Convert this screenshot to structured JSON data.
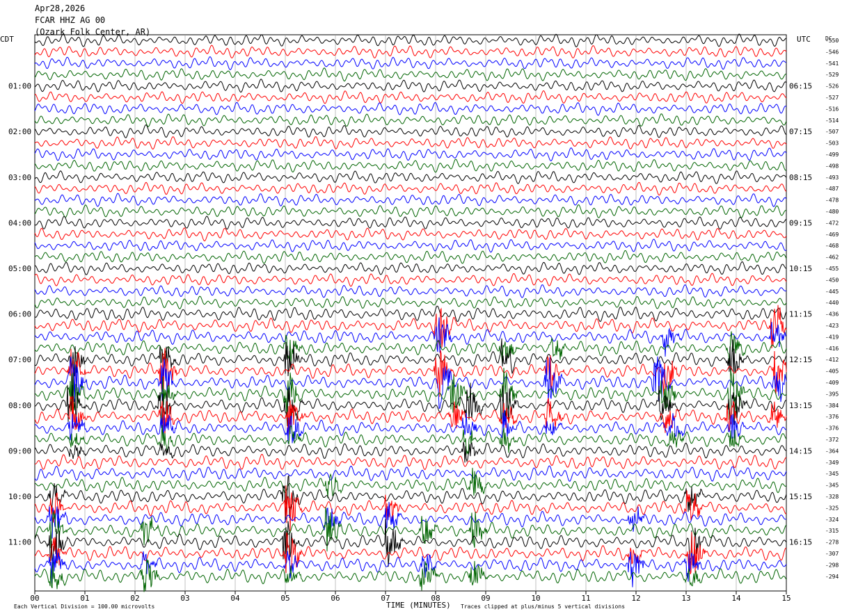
{
  "header": {
    "date": "Apr28,2026",
    "channel": "FCAR HHZ AG 00",
    "site": "(Ozark Folk Center, AR)"
  },
  "footer": {
    "scale_note": "Each Vertical Division = 100.00 microvolts",
    "clip_note": "Traces clipped at plus/minus 5 vertical divisions"
  },
  "chart_data": {
    "type": "line",
    "title": "",
    "xlabel": "TIME (MINUTES)",
    "left_axis_label": "CDT",
    "right_axis_label": "UTC",
    "dc_label": "DC",
    "x_range": [
      0,
      15
    ],
    "x_ticks": [
      "00",
      "01",
      "02",
      "03",
      "04",
      "05",
      "06",
      "07",
      "08",
      "09",
      "10",
      "11",
      "12",
      "13",
      "14",
      "15"
    ],
    "trace_colors": [
      "#000000",
      "#ff0000",
      "#0000ff",
      "#006400"
    ],
    "row_count": 48,
    "left_time_labels": [
      {
        "row": 4,
        "label": "01:00"
      },
      {
        "row": 8,
        "label": "02:00"
      },
      {
        "row": 12,
        "label": "03:00"
      },
      {
        "row": 16,
        "label": "04:00"
      },
      {
        "row": 20,
        "label": "05:00"
      },
      {
        "row": 24,
        "label": "06:00"
      },
      {
        "row": 28,
        "label": "07:00"
      },
      {
        "row": 32,
        "label": "08:00"
      },
      {
        "row": 36,
        "label": "09:00"
      },
      {
        "row": 40,
        "label": "10:00"
      },
      {
        "row": 44,
        "label": "11:00"
      }
    ],
    "right_time_labels": [
      {
        "row": 4,
        "label": "06:15"
      },
      {
        "row": 8,
        "label": "07:15"
      },
      {
        "row": 12,
        "label": "08:15"
      },
      {
        "row": 16,
        "label": "09:15"
      },
      {
        "row": 20,
        "label": "10:15"
      },
      {
        "row": 24,
        "label": "11:15"
      },
      {
        "row": 28,
        "label": "12:15"
      },
      {
        "row": 32,
        "label": "13:15"
      },
      {
        "row": 36,
        "label": "14:15"
      },
      {
        "row": 40,
        "label": "15:15"
      },
      {
        "row": 44,
        "label": "16:15"
      }
    ],
    "dc_offsets": [
      "-550",
      "-546",
      "-541",
      "-529",
      "-526",
      "-527",
      "-516",
      "-514",
      "-507",
      "-503",
      "-499",
      "-498",
      "-493",
      "-487",
      "-478",
      "-480",
      "-472",
      "-469",
      "-468",
      "-462",
      "-455",
      "-450",
      "-445",
      "-440",
      "-436",
      "-423",
      "-419",
      "-416",
      "-412",
      "-405",
      "-409",
      "-395",
      "-384",
      "-376",
      "-376",
      "-372",
      "-364",
      "-349",
      "-345",
      "-345",
      "-328",
      "-325",
      "-324",
      "-315",
      "-278",
      "-307",
      "-298",
      "-294"
    ],
    "events": [
      {
        "row": 28,
        "x": 0.75,
        "amp": 4
      },
      {
        "row": 29,
        "x": 0.75,
        "amp": 5
      },
      {
        "row": 30,
        "x": 0.75,
        "amp": 5
      },
      {
        "row": 31,
        "x": 0.75,
        "amp": 4
      },
      {
        "row": 32,
        "x": 0.7,
        "amp": 5
      },
      {
        "row": 33,
        "x": 0.75,
        "amp": 4
      },
      {
        "row": 34,
        "x": 0.75,
        "amp": 3
      },
      {
        "row": 35,
        "x": 0.75,
        "amp": 2
      },
      {
        "row": 36,
        "x": 0.75,
        "amp": 1.5
      },
      {
        "row": 28,
        "x": 2.55,
        "amp": 3
      },
      {
        "row": 29,
        "x": 2.55,
        "amp": 5
      },
      {
        "row": 30,
        "x": 2.55,
        "amp": 4
      },
      {
        "row": 31,
        "x": 2.55,
        "amp": 3.5
      },
      {
        "row": 32,
        "x": 2.5,
        "amp": 5
      },
      {
        "row": 33,
        "x": 2.55,
        "amp": 3.5
      },
      {
        "row": 34,
        "x": 2.55,
        "amp": 3
      },
      {
        "row": 35,
        "x": 2.55,
        "amp": 2
      },
      {
        "row": 36,
        "x": 2.55,
        "amp": 1.5
      },
      {
        "row": 27,
        "x": 5.05,
        "amp": 3
      },
      {
        "row": 28,
        "x": 5.05,
        "amp": 4
      },
      {
        "row": 31,
        "x": 5.05,
        "amp": 5
      },
      {
        "row": 32,
        "x": 5.05,
        "amp": 5
      },
      {
        "row": 33,
        "x": 5.1,
        "amp": 4
      },
      {
        "row": 34,
        "x": 5.1,
        "amp": 3
      },
      {
        "row": 35,
        "x": 5.1,
        "amp": 2
      },
      {
        "row": 25,
        "x": 8.05,
        "amp": 5
      },
      {
        "row": 26,
        "x": 8.05,
        "amp": 4
      },
      {
        "row": 29,
        "x": 8.05,
        "amp": 5
      },
      {
        "row": 30,
        "x": 8.1,
        "amp": 5
      },
      {
        "row": 31,
        "x": 8.35,
        "amp": 4
      },
      {
        "row": 32,
        "x": 8.65,
        "amp": 5
      },
      {
        "row": 33,
        "x": 8.35,
        "amp": 3
      },
      {
        "row": 34,
        "x": 8.6,
        "amp": 3
      },
      {
        "row": 35,
        "x": 8.6,
        "amp": 2
      },
      {
        "row": 36,
        "x": 8.6,
        "amp": 2
      },
      {
        "row": 27,
        "x": 9.35,
        "amp": 3
      },
      {
        "row": 28,
        "x": 9.35,
        "amp": 4
      },
      {
        "row": 31,
        "x": 9.35,
        "amp": 5
      },
      {
        "row": 32,
        "x": 9.35,
        "amp": 5
      },
      {
        "row": 33,
        "x": 9.35,
        "amp": 3
      },
      {
        "row": 34,
        "x": 9.35,
        "amp": 3
      },
      {
        "row": 35,
        "x": 9.35,
        "amp": 2
      },
      {
        "row": 29,
        "x": 10.25,
        "amp": 4
      },
      {
        "row": 30,
        "x": 10.25,
        "amp": 5
      },
      {
        "row": 33,
        "x": 10.25,
        "amp": 3
      },
      {
        "row": 34,
        "x": 10.25,
        "amp": 2
      },
      {
        "row": 27,
        "x": 10.35,
        "amp": 2.5
      },
      {
        "row": 29,
        "x": 12.6,
        "amp": 4
      },
      {
        "row": 30,
        "x": 12.4,
        "amp": 5
      },
      {
        "row": 31,
        "x": 12.55,
        "amp": 4
      },
      {
        "row": 32,
        "x": 12.5,
        "amp": 3
      },
      {
        "row": 33,
        "x": 12.6,
        "amp": 3
      },
      {
        "row": 34,
        "x": 12.7,
        "amp": 3
      },
      {
        "row": 35,
        "x": 12.7,
        "amp": 2
      },
      {
        "row": 26,
        "x": 12.6,
        "amp": 2.5
      },
      {
        "row": 27,
        "x": 13.9,
        "amp": 3
      },
      {
        "row": 28,
        "x": 13.9,
        "amp": 4
      },
      {
        "row": 31,
        "x": 13.9,
        "amp": 5
      },
      {
        "row": 32,
        "x": 13.9,
        "amp": 5
      },
      {
        "row": 33,
        "x": 13.85,
        "amp": 4
      },
      {
        "row": 34,
        "x": 13.9,
        "amp": 3
      },
      {
        "row": 35,
        "x": 13.9,
        "amp": 2
      },
      {
        "row": 25,
        "x": 14.75,
        "amp": 5
      },
      {
        "row": 26,
        "x": 14.75,
        "amp": 4
      },
      {
        "row": 29,
        "x": 14.8,
        "amp": 5
      },
      {
        "row": 30,
        "x": 14.8,
        "amp": 3
      },
      {
        "row": 33,
        "x": 14.75,
        "amp": 3
      },
      {
        "row": 40,
        "x": 0.35,
        "amp": 3
      },
      {
        "row": 41,
        "x": 0.35,
        "amp": 4
      },
      {
        "row": 42,
        "x": 0.35,
        "amp": 4
      },
      {
        "row": 43,
        "x": 0.35,
        "amp": 4
      },
      {
        "row": 44,
        "x": 0.35,
        "amp": 5
      },
      {
        "row": 45,
        "x": 0.35,
        "amp": 3
      },
      {
        "row": 46,
        "x": 0.35,
        "amp": 3
      },
      {
        "row": 47,
        "x": 0.35,
        "amp": 3
      },
      {
        "row": 43,
        "x": 2.2,
        "amp": 3
      },
      {
        "row": 47,
        "x": 2.2,
        "amp": 4
      },
      {
        "row": 46,
        "x": 2.2,
        "amp": 2
      },
      {
        "row": 40,
        "x": 5.0,
        "amp": 5
      },
      {
        "row": 41,
        "x": 5.05,
        "amp": 5
      },
      {
        "row": 44,
        "x": 5.0,
        "amp": 5
      },
      {
        "row": 45,
        "x": 5.05,
        "amp": 5
      },
      {
        "row": 46,
        "x": 5.05,
        "amp": 3
      },
      {
        "row": 47,
        "x": 5.05,
        "amp": 2
      },
      {
        "row": 39,
        "x": 5.85,
        "amp": 3
      },
      {
        "row": 43,
        "x": 5.85,
        "amp": 5
      },
      {
        "row": 42,
        "x": 5.85,
        "amp": 3
      },
      {
        "row": 41,
        "x": 7.05,
        "amp": 3
      },
      {
        "row": 44,
        "x": 7.05,
        "amp": 5
      },
      {
        "row": 42,
        "x": 7.05,
        "amp": 3
      },
      {
        "row": 47,
        "x": 7.75,
        "amp": 5
      },
      {
        "row": 46,
        "x": 7.75,
        "amp": 3
      },
      {
        "row": 43,
        "x": 7.75,
        "amp": 3
      },
      {
        "row": 39,
        "x": 8.75,
        "amp": 3
      },
      {
        "row": 43,
        "x": 8.75,
        "amp": 5
      },
      {
        "row": 47,
        "x": 8.75,
        "amp": 3
      },
      {
        "row": 42,
        "x": 11.9,
        "amp": 3
      },
      {
        "row": 46,
        "x": 11.9,
        "amp": 5
      },
      {
        "row": 45,
        "x": 11.9,
        "amp": 2
      },
      {
        "row": 40,
        "x": 13.05,
        "amp": 3
      },
      {
        "row": 41,
        "x": 13.05,
        "amp": 4
      },
      {
        "row": 44,
        "x": 13.1,
        "amp": 4
      },
      {
        "row": 45,
        "x": 13.1,
        "amp": 5
      },
      {
        "row": 46,
        "x": 13.05,
        "amp": 3
      },
      {
        "row": 47,
        "x": 13.05,
        "amp": 2
      }
    ]
  }
}
